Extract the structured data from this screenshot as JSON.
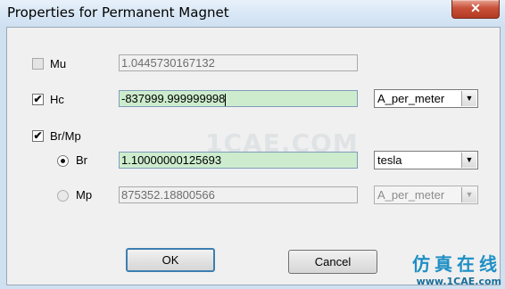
{
  "window": {
    "title": "Properties for Permanent Magnet",
    "close_glyph": "✕"
  },
  "mu": {
    "label": "Mu",
    "checked": false,
    "value": "1.0445730167132"
  },
  "hc": {
    "label": "Hc",
    "checked": true,
    "value": "-837999.999999998",
    "unit": "A_per_meter"
  },
  "brmp": {
    "label": "Br/Mp",
    "checked": true
  },
  "br": {
    "label": "Br",
    "selected": true,
    "value": "1.10000000125693",
    "unit": "tesla"
  },
  "mp": {
    "label": "Mp",
    "selected": false,
    "value": "875352.18800566",
    "unit": "A_per_meter"
  },
  "buttons": {
    "ok": "OK",
    "cancel": "Cancel"
  },
  "watermark": {
    "text": "1CAE.COM"
  },
  "badge": {
    "chinese": "仿真在线",
    "url": "www.1CAE.com"
  },
  "check_glyph": "✔",
  "colors": {
    "active_field": "#cdeccd",
    "title_bar": "#d6e6f5"
  }
}
